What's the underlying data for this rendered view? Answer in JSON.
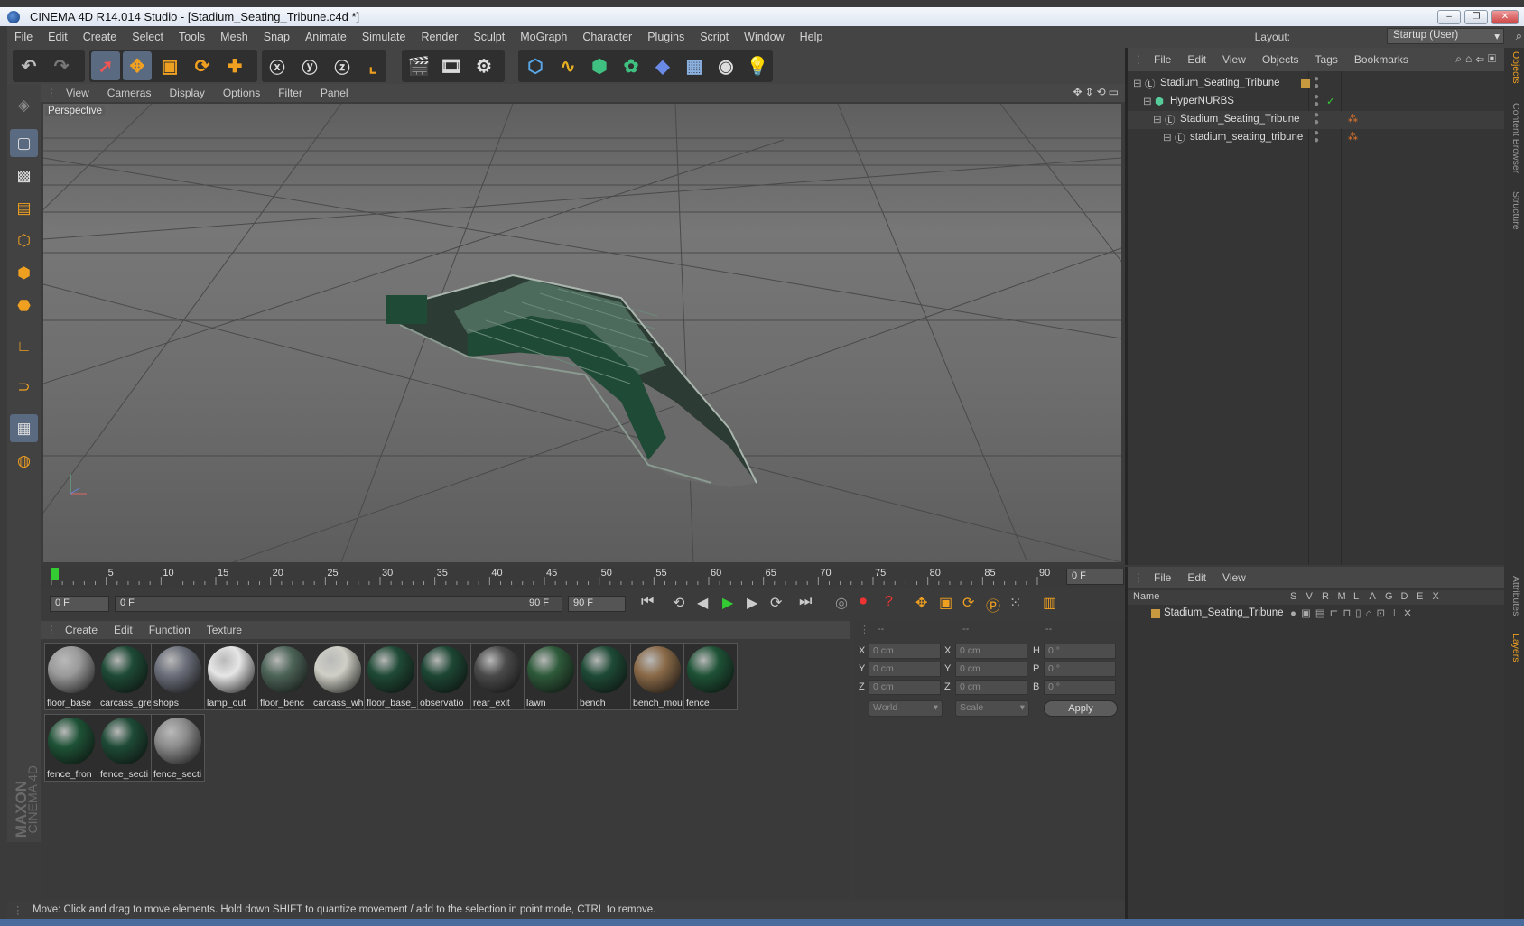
{
  "title": "CINEMA 4D R14.014 Studio - [Stadium_Seating_Tribune.c4d *]",
  "window_controls": {
    "minimize": "–",
    "restore": "❐",
    "close": "✕"
  },
  "menu": [
    "File",
    "Edit",
    "Create",
    "Select",
    "Tools",
    "Mesh",
    "Snap",
    "Animate",
    "Simulate",
    "Render",
    "Sculpt",
    "MoGraph",
    "Character",
    "Plugins",
    "Script",
    "Window",
    "Help"
  ],
  "layout": {
    "label": "Layout:",
    "value": "Startup (User)"
  },
  "viewport": {
    "menu": [
      "View",
      "Cameras",
      "Display",
      "Options",
      "Filter",
      "Panel"
    ],
    "label": "Perspective"
  },
  "timeline": {
    "ticks": [
      "0",
      "5",
      "10",
      "15",
      "20",
      "25",
      "30",
      "35",
      "40",
      "45",
      "50",
      "55",
      "60",
      "65",
      "70",
      "75",
      "80",
      "85",
      "90"
    ],
    "end_field": "0 F"
  },
  "playbar": {
    "start": "0 F",
    "range_start": "0 F",
    "range_end": "90 F",
    "end": "90 F"
  },
  "materials": {
    "menu": [
      "Create",
      "Edit",
      "Function",
      "Texture"
    ],
    "items": [
      {
        "name": "floor_base",
        "color": "#9a9a9a"
      },
      {
        "name": "carcass_gre",
        "color": "#1e4a36"
      },
      {
        "name": "shops",
        "color": "#6b6f7a"
      },
      {
        "name": "lamp_out",
        "color": "#e6e6e6"
      },
      {
        "name": "floor_benc",
        "color": "#4d6458"
      },
      {
        "name": "carcass_wh",
        "color": "#cfcfc6"
      },
      {
        "name": "floor_base_",
        "color": "#1f4a36"
      },
      {
        "name": "observatio",
        "color": "#1d4634"
      },
      {
        "name": "rear_exit",
        "color": "#4a4a4a"
      },
      {
        "name": "lawn",
        "color": "#2e5a3a"
      },
      {
        "name": "bench",
        "color": "#1e4a36"
      },
      {
        "name": "bench_mou",
        "color": "#8a6a48"
      },
      {
        "name": "fence",
        "color": "#1e5236"
      },
      {
        "name": "fence_fron",
        "color": "#1e5236"
      },
      {
        "name": "fence_secti",
        "color": "#1e4a36"
      },
      {
        "name": "fence_secti",
        "color": "#8c8c8c"
      }
    ]
  },
  "coords": {
    "headers": [
      "--",
      "--",
      "--"
    ],
    "pos_labels": [
      "X",
      "Y",
      "Z"
    ],
    "size_labels": [
      "X",
      "Y",
      "Z"
    ],
    "rot_labels": [
      "H",
      "P",
      "B"
    ],
    "values": [
      "0 cm",
      "0 cm",
      "0 cm",
      "0 cm",
      "0 cm",
      "0 cm",
      "0 °",
      "0 °",
      "0 °"
    ],
    "mode": "World",
    "scale": "Scale",
    "apply": "Apply"
  },
  "status": "Move: Click and drag to move elements. Hold down SHIFT to quantize movement / add to the selection in point mode, CTRL to remove.",
  "objects": {
    "menu": [
      "File",
      "Edit",
      "View",
      "Objects",
      "Tags",
      "Bookmarks"
    ],
    "rows": [
      {
        "name": "Stadium_Seating_Tribune",
        "indent": 0
      },
      {
        "name": "HyperNURBS",
        "indent": 1
      },
      {
        "name": "Stadium_Seating_Tribune",
        "indent": 2
      },
      {
        "name": "stadium_seating_tribune",
        "indent": 3
      }
    ]
  },
  "layers": {
    "menu": [
      "File",
      "Edit",
      "View"
    ],
    "name_header": "Name",
    "flags": [
      "S",
      "V",
      "R",
      "M",
      "L",
      "A",
      "G",
      "D",
      "E",
      "X"
    ],
    "row": "Stadium_Seating_Tribune"
  },
  "side_tabs": [
    "Objects",
    "Content Browser",
    "Structure",
    "Attributes",
    "Layers"
  ],
  "brand": {
    "maxon": "MAXON",
    "c4d": "CINEMA 4D"
  },
  "accent": "#f0a020"
}
